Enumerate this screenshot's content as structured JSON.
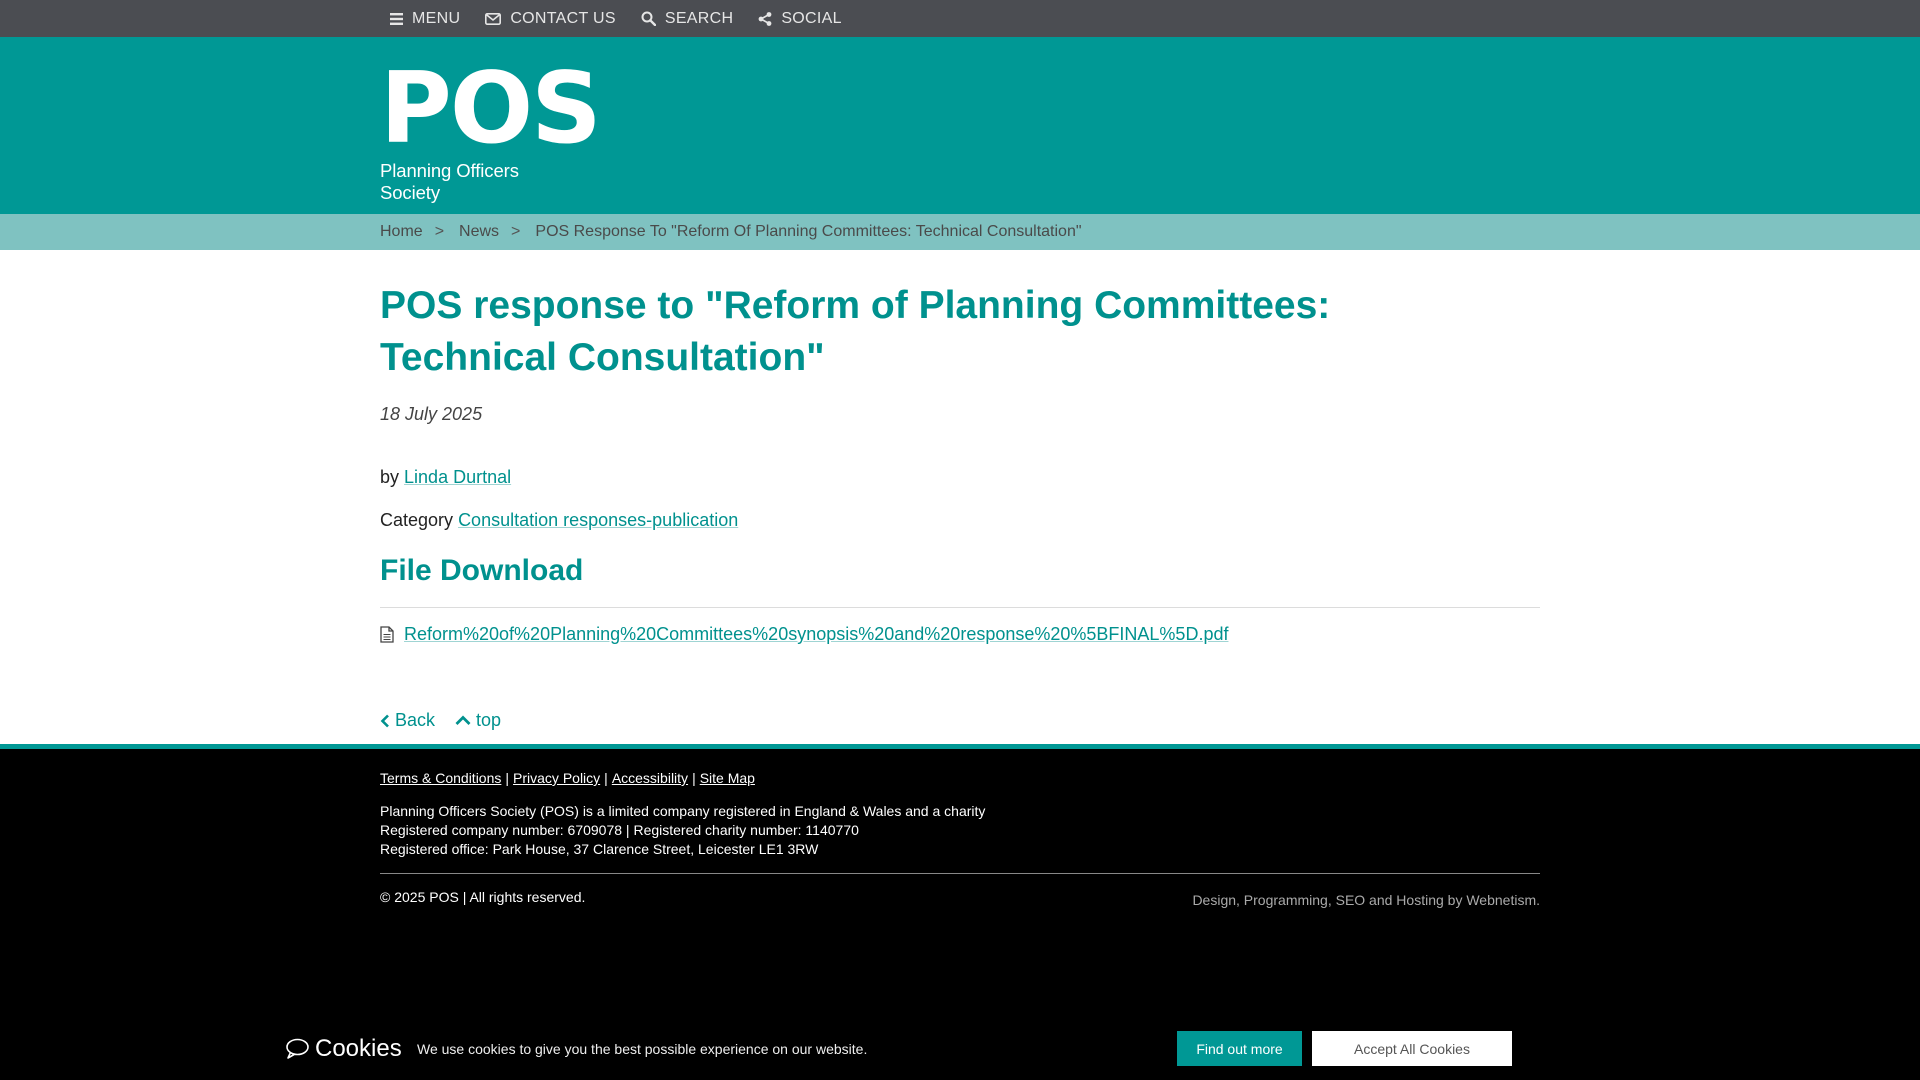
{
  "topnav": {
    "menu": {
      "label": "MENU",
      "icon": "bars-icon"
    },
    "contact": {
      "label": "CONTACT US",
      "icon": "envelope-icon"
    },
    "search": {
      "label": "SEARCH",
      "icon": "search-icon"
    },
    "social": {
      "label": "SOCIAL",
      "icon": "share-icon"
    }
  },
  "logo": {
    "mark": "POS",
    "subtitle": "Planning Officers Society"
  },
  "breadcrumb": {
    "home": "Home",
    "news": "News",
    "current": "POS Response To \"Reform Of Planning Committees: Technical Consultation\"",
    "separator": ">"
  },
  "article": {
    "title": "POS response to \"Reform of Planning Committees: Technical Consultation\"",
    "date": "18 July 2025",
    "by_label": "by",
    "author": "Linda Durtnal",
    "category_label": "Category",
    "category": "Consultation responses-publication"
  },
  "download": {
    "heading": "File Download",
    "file_name": "Reform%20of%20Planning%20Committees%20synopsis%20and%20response%20%5BFINAL%5D.pdf",
    "file_icon": "file-icon"
  },
  "pager": {
    "back": "Back",
    "top": "top"
  },
  "footer": {
    "links": [
      "Terms & Conditions",
      "Privacy Policy",
      "Accessibility",
      "Site Map"
    ],
    "separator": "|",
    "info": [
      "Planning Officers Society (POS) is a limited company registered in England & Wales and a charity",
      "Registered company number: 6709078 | Registered charity number: 1140770",
      "Registered office: Park House, 37 Clarence Street, Leicester LE1 3RW"
    ],
    "copyright": "© 2025 POS | All rights reserved.",
    "credit": "Design, Programming, SEO and Hosting by Webnetism."
  },
  "cookies": {
    "title": "Cookies",
    "message": "We use cookies to give you the best possible experience on our website.",
    "find_out_more": "Find out more",
    "accept_all": "Accept All Cookies"
  },
  "colors": {
    "brand_teal": "#009895",
    "breadcrumb_bg": "#7fc2c1",
    "topbar_bg": "#4b4d52",
    "footer_bg": "#000000"
  }
}
